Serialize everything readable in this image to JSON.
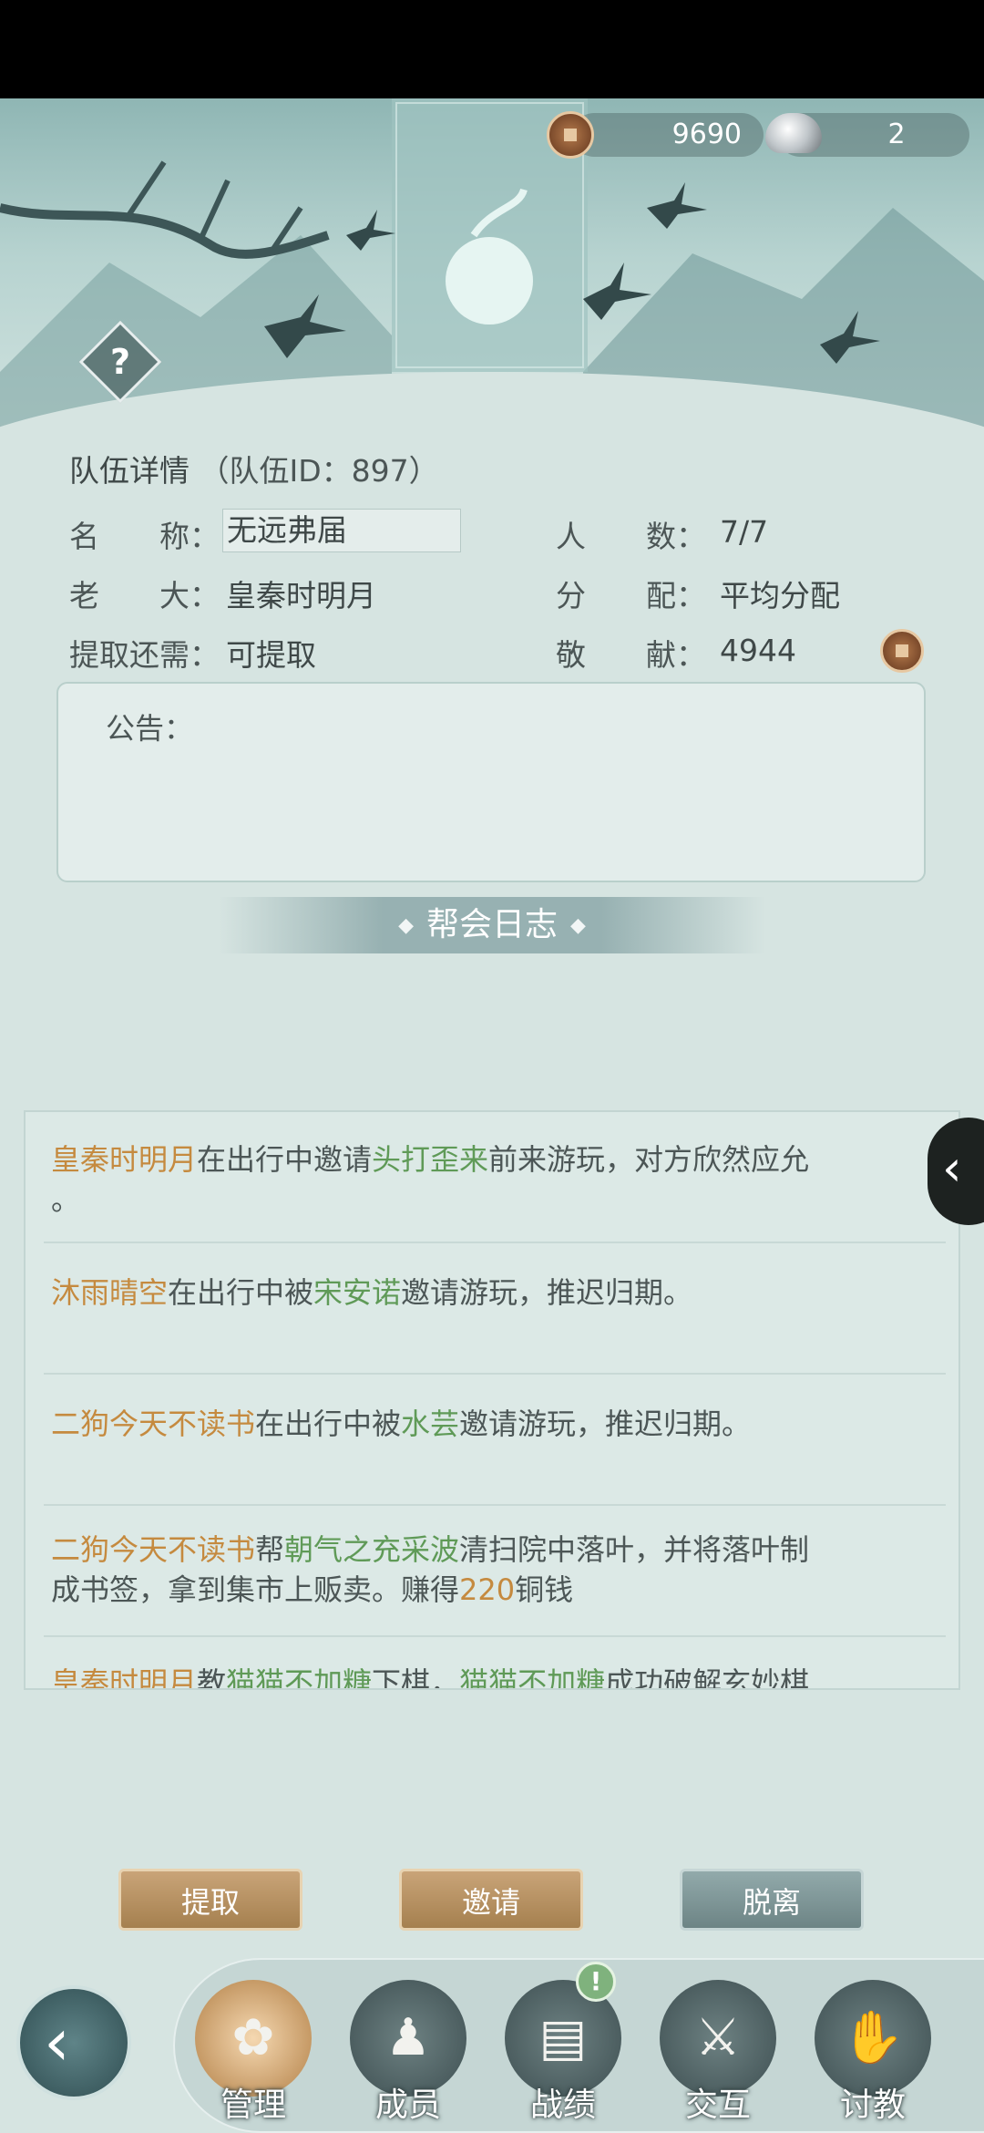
{
  "header": {
    "copper_amount": "9690",
    "silver_amount": "2",
    "help_label": "?"
  },
  "team": {
    "title": "队伍详情",
    "id_text": "（队伍ID：897）",
    "name_label": "名　　称：",
    "name_value": "无远弗届",
    "boss_label": "老　　大：",
    "boss_value": "皇秦时明月",
    "withdraw_label": "提取还需：",
    "withdraw_value": "可提取",
    "members_label": "人　　数：",
    "members_value": "7/7",
    "distribute_label": "分　　配：",
    "distribute_value": "平均分配",
    "contribution_label": "敬　　献：",
    "contribution_value": "4944"
  },
  "notice": {
    "label": "公告："
  },
  "log": {
    "title": "帮会日志",
    "entries": [
      {
        "a": "皇秦时明月",
        "b": "在出行中邀请",
        "c": "头打歪来",
        "d": "前来游玩，对方欣然应允",
        "e": "。"
      },
      {
        "a": "沐雨晴空",
        "b": "在出行中被",
        "c": "宋安诺",
        "d": "邀请游玩，推迟归期。"
      },
      {
        "a": "二狗今天不读书",
        "b": "在出行中被",
        "c": "水芸",
        "d": "邀请游玩，推迟归期。"
      },
      {
        "a": "二狗今天不读书",
        "b": "帮",
        "c": "朝气之充采波",
        "d": "清扫院中落叶，并将落叶制",
        "e": "成书签，拿到集市上贩卖。赚得",
        "f": "220",
        "g": "铜钱"
      },
      {
        "a": "皇秦时明月",
        "b": "教",
        "c": "猫猫不加糖",
        "d": "下棋，",
        "e": "猫猫不加糖",
        "f": "成功破解玄妙棋"
      }
    ]
  },
  "actions": {
    "withdraw": "提取",
    "invite": "邀请",
    "leave": "脱离"
  },
  "nav": {
    "manage": "管理",
    "members": "成员",
    "records": "战绩",
    "interact": "交互",
    "teach": "讨教",
    "records_alert": "!"
  },
  "icons": {
    "back": "chevron-left-icon",
    "copper": "copper-coin-icon",
    "silver": "silver-ingot-icon"
  }
}
